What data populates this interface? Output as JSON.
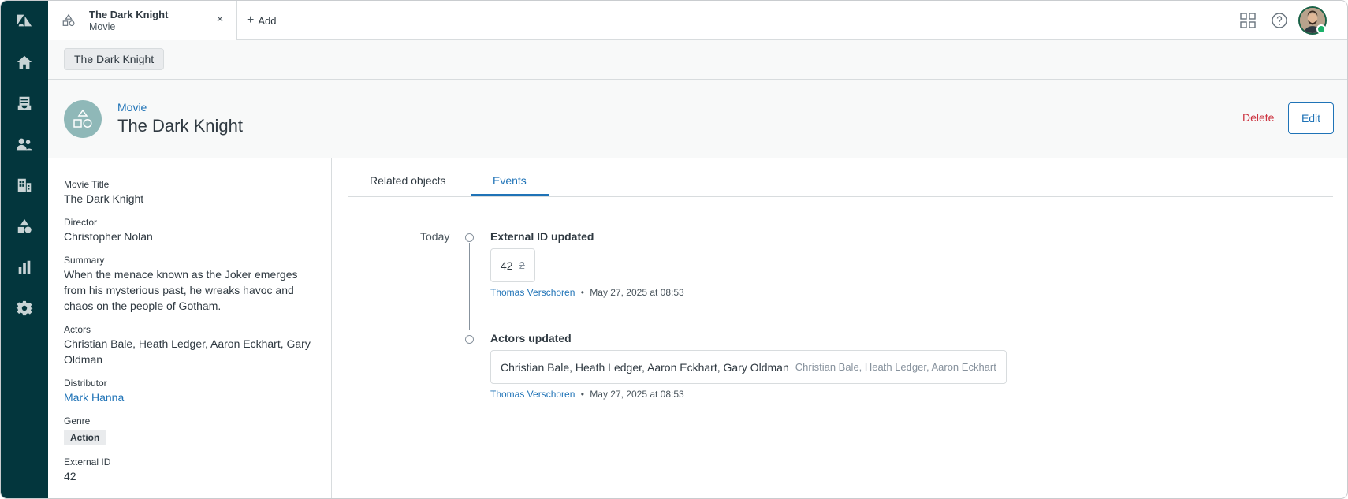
{
  "tab": {
    "title": "The Dark Knight",
    "subtitle": "Movie",
    "close": "×"
  },
  "add": {
    "icon": "+",
    "label": "Add"
  },
  "breadcrumb": "The Dark Knight",
  "header": {
    "type": "Movie",
    "name": "The Dark Knight",
    "delete_label": "Delete",
    "edit_label": "Edit"
  },
  "details": [
    {
      "label": "Movie Title",
      "value": "The Dark Knight"
    },
    {
      "label": "Director",
      "value": "Christopher Nolan"
    },
    {
      "label": "Summary",
      "value": "When the menace known as the Joker emerges from his mysterious past, he wreaks havoc and chaos on the people of Gotham."
    },
    {
      "label": "Actors",
      "value": "Christian Bale, Heath Ledger, Aaron Eckhart, Gary Oldman"
    },
    {
      "label": "Distributor",
      "value": "Mark Hanna"
    },
    {
      "label": "Genre",
      "value": "Action"
    },
    {
      "label": "External ID",
      "value": "42"
    }
  ],
  "panel_tabs": [
    "Related objects",
    "Events"
  ],
  "timeline": {
    "day": "Today",
    "events": [
      {
        "title": "External ID updated",
        "new_value": "42",
        "old_value": "2",
        "user": "Thomas Verschoren",
        "separator": "•",
        "time": "May 27, 2025 at 08:53"
      },
      {
        "title": "Actors updated",
        "new_value": "Christian Bale, Heath Ledger, Aaron Eckhart, Gary Oldman",
        "old_value": "Christian Bale, Heath Ledger, Aaron Eckhart",
        "user": "Thomas Verschoren",
        "separator": "•",
        "time": "May 27, 2025 at 08:53"
      }
    ]
  },
  "colors": {
    "nav_bg": "#03363d",
    "accent": "#1f73b7",
    "danger": "#cc3340",
    "object_avatar": "#8fb8b8",
    "presence": "#1bb26a"
  },
  "icons": {
    "nav": [
      "zendesk-logo-icon",
      "home-icon",
      "inbox-icon",
      "users-icon",
      "building-icon",
      "shapes-icon",
      "bar-chart-icon",
      "gear-icon"
    ],
    "top": [
      "grid-apps-icon",
      "help-icon",
      "user-avatar"
    ]
  }
}
